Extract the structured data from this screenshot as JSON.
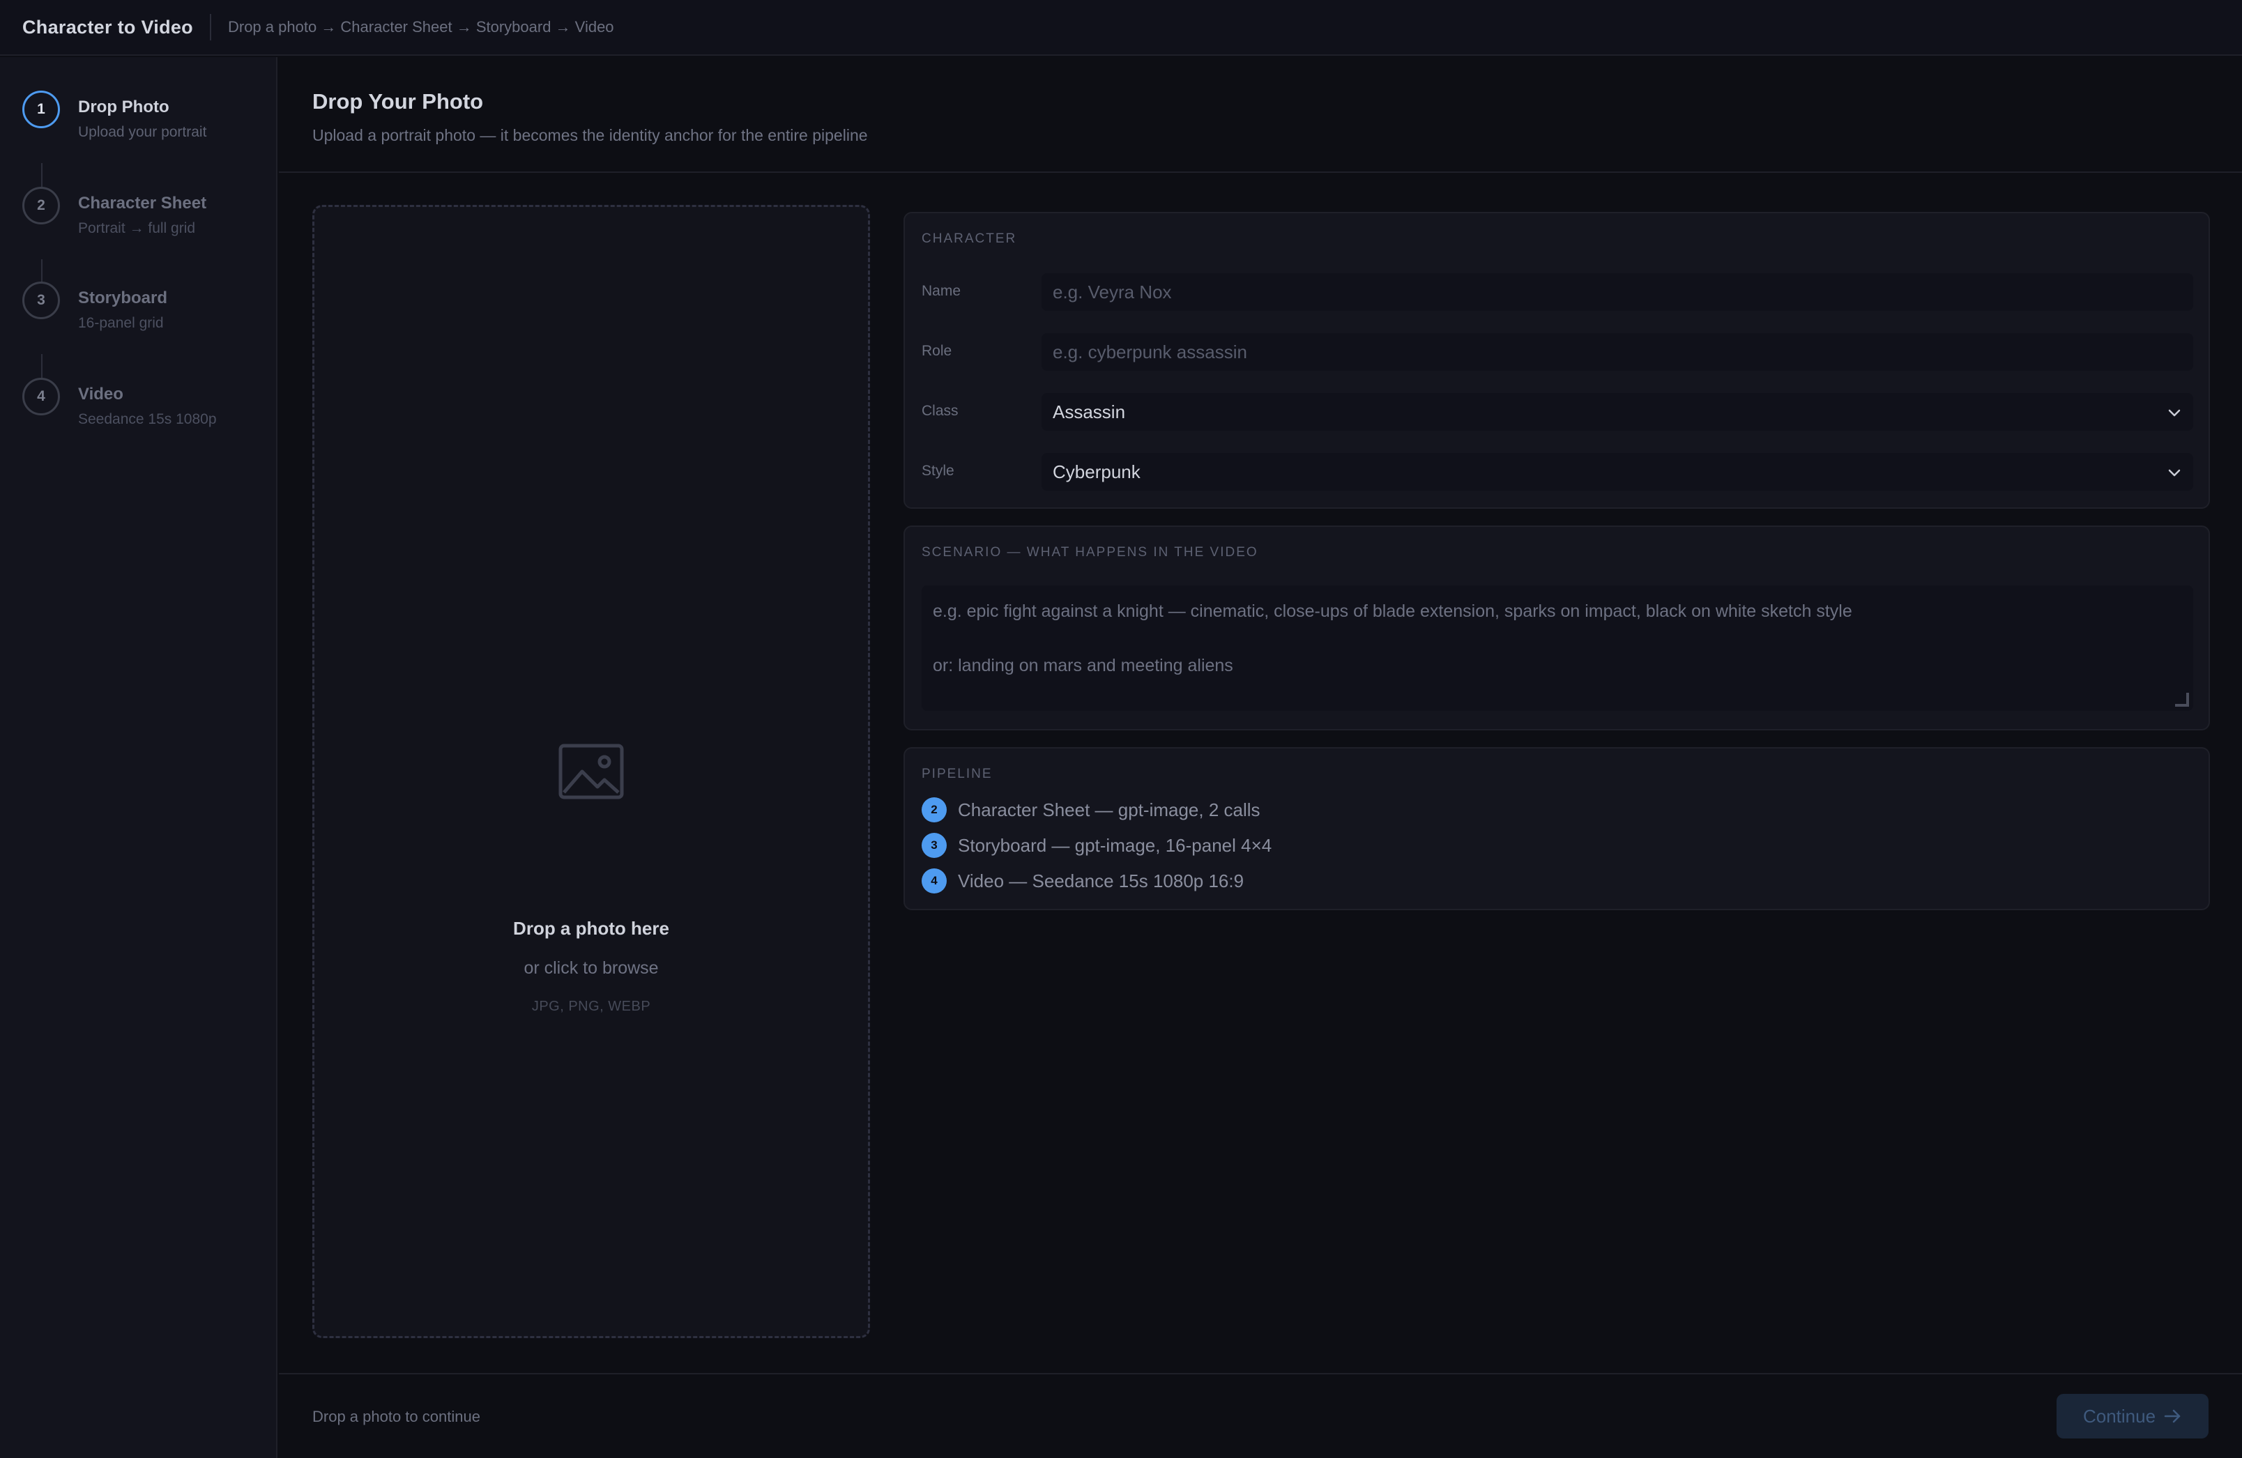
{
  "app": {
    "title": "Character to Video",
    "breadcrumb": "Drop a photo → Character Sheet → Storyboard → Video"
  },
  "sidebar": {
    "steps": [
      {
        "number": "1",
        "title": "Drop Photo",
        "subtitle": "Upload your portrait",
        "active": true
      },
      {
        "number": "2",
        "title": "Character Sheet",
        "subtitle": "Portrait → full grid",
        "active": false
      },
      {
        "number": "3",
        "title": "Storyboard",
        "subtitle": "16-panel grid",
        "active": false
      },
      {
        "number": "4",
        "title": "Video",
        "subtitle": "Seedance 15s 1080p",
        "active": false
      }
    ]
  },
  "page": {
    "title": "Drop Your Photo",
    "subtitle": "Upload a portrait photo — it becomes the identity anchor for the entire pipeline"
  },
  "dropzone": {
    "icon": "image-icon",
    "title": "Drop a photo here",
    "subtitle": "or click to browse",
    "formats": "JPG, PNG, WEBP"
  },
  "character": {
    "section_label": "CHARACTER",
    "name_label": "Name",
    "name_placeholder": "e.g. Veyra Nox",
    "role_label": "Role",
    "role_placeholder": "e.g. cyberpunk assassin",
    "class_label": "Class",
    "class_value": "Assassin",
    "style_label": "Style",
    "style_value": "Cyberpunk"
  },
  "scenario": {
    "section_label": "SCENARIO — WHAT HAPPENS IN THE VIDEO",
    "placeholder_line1": "e.g. epic fight against a knight — cinematic, close-ups of blade extension, sparks on impact, black on white sketch style",
    "placeholder_line2": "or: landing on mars and meeting aliens"
  },
  "pipeline": {
    "section_label": "PIPELINE",
    "items": [
      {
        "number": "2",
        "text": "Character Sheet — gpt-image, 2 calls"
      },
      {
        "number": "3",
        "text": "Storyboard — gpt-image, 16-panel 4×4"
      },
      {
        "number": "4",
        "text": "Video — Seedance 15s 1080p 16:9"
      }
    ]
  },
  "footer": {
    "hint": "Drop a photo to continue",
    "continue_label": "Continue"
  },
  "colors": {
    "accent": "#4e9bf0",
    "background": "#0d0e14",
    "panel": "#14151e"
  }
}
